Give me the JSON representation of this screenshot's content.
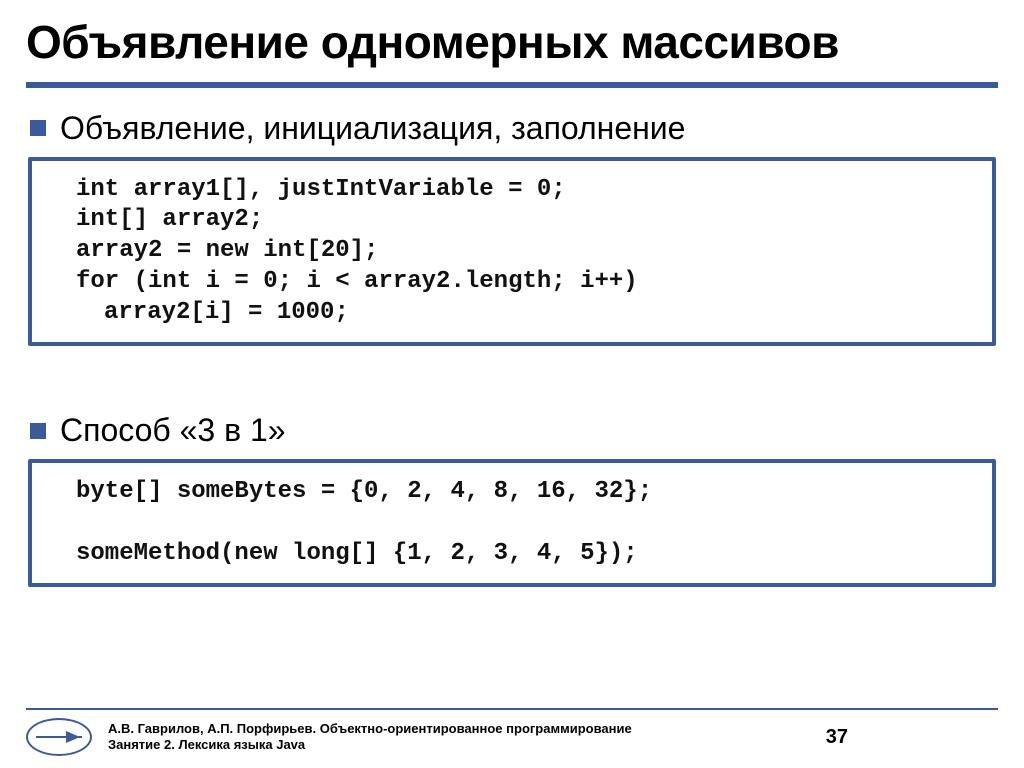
{
  "title": "Объявление одномерных массивов",
  "bullets": {
    "b1": "Объявление, инициализация, заполнение",
    "b2": "Способ «3 в 1»"
  },
  "code1": {
    "l1": "int array1[], justIntVariable = 0;",
    "l2": "int[] array2;",
    "l3": "array2 = new int[20];",
    "l4": "for (int i = 0; i < array2.length; i++)",
    "l5": "array2[i] = 1000;"
  },
  "code2": {
    "l1": "byte[] someBytes = {0, 2, 4, 8, 16, 32};",
    "l2": "someMethod(new long[] {1, 2, 3, 4, 5});"
  },
  "footer": {
    "authors": "А.В. Гаврилов, А.П. Порфирьев. Объектно-ориентированное программирование",
    "lesson": "Занятие 2. Лексика языка Java",
    "page": "37"
  }
}
